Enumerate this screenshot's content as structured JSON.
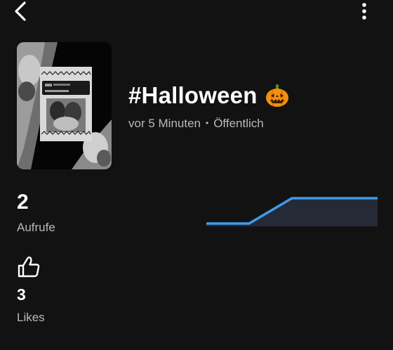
{
  "header": {
    "back_icon": "chevron-left-icon",
    "more_icon": "more-vertical-icon"
  },
  "sound": {
    "title": "#Halloween",
    "title_emoji": "jack-o-lantern-icon",
    "time_ago": "vor 5 Minuten",
    "separator": "•",
    "visibility": "Öffentlich"
  },
  "stats": {
    "views_count": "2",
    "views_label": "Aufrufe",
    "likes_icon": "thumbs-up-icon",
    "likes_count": "3",
    "likes_label": "Likes"
  },
  "chart_data": {
    "type": "area",
    "x": [
      0,
      1,
      2,
      3,
      4
    ],
    "values": [
      1,
      1,
      2,
      2,
      2
    ],
    "title": "",
    "xlabel": "",
    "ylabel": "",
    "ylim": [
      1,
      2
    ],
    "grid": false,
    "line_color": "#3d9bf0",
    "fill_color": "#262a36"
  },
  "colors": {
    "background": "#121212",
    "text_primary": "#ffffff",
    "text_secondary": "#b9b9b9",
    "accent": "#3d9bf0"
  }
}
